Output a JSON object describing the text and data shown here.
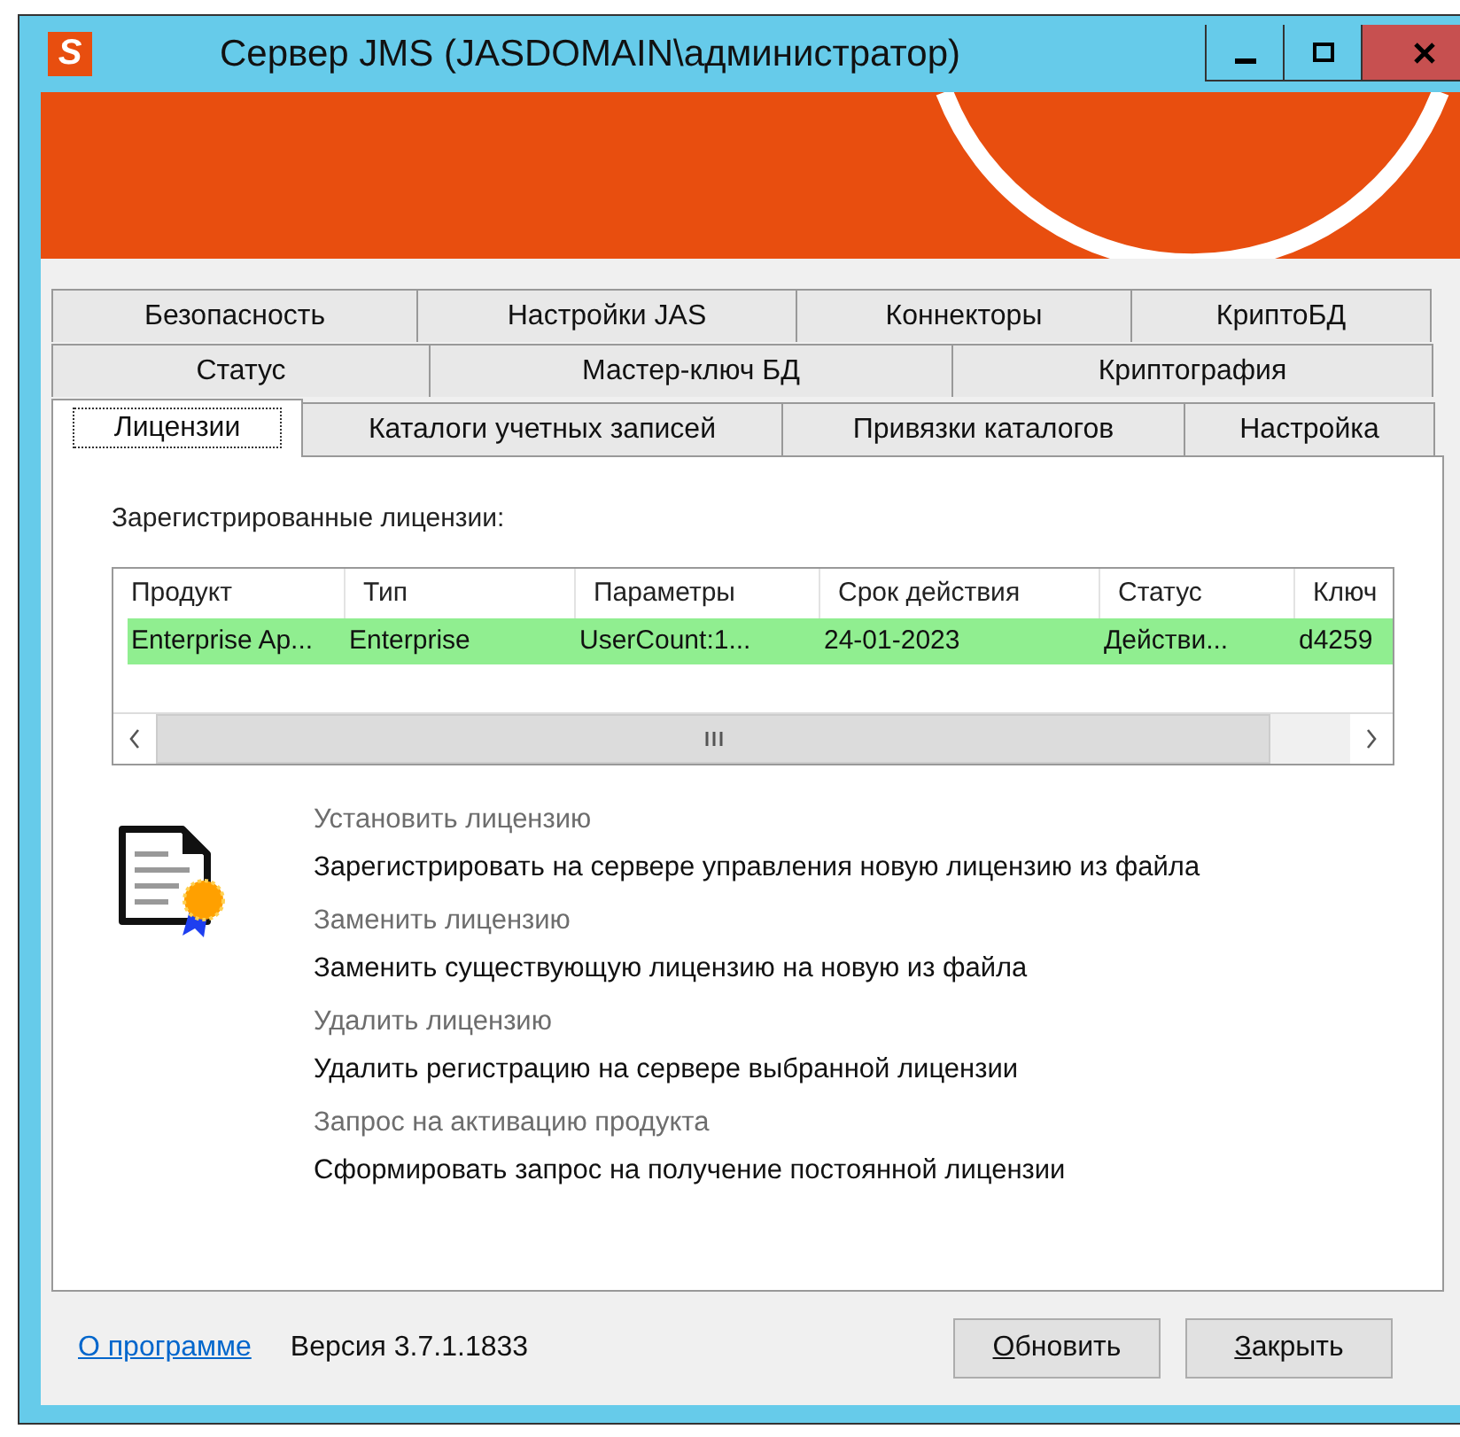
{
  "window": {
    "title": "Сервер JMS (JASDOMAIN\\администратор)",
    "app_icon_letter": "S"
  },
  "tab_rows": [
    [
      {
        "label": "Безопасность",
        "selected": false
      },
      {
        "label": "Настройки JAS",
        "selected": false
      },
      {
        "label": "Коннекторы",
        "selected": false
      },
      {
        "label": "КриптоБД",
        "selected": false
      }
    ],
    [
      {
        "label": "Статус",
        "selected": false
      },
      {
        "label": "Мастер-ключ БД",
        "selected": false
      },
      {
        "label": "Криптография",
        "selected": false
      }
    ],
    [
      {
        "label": "Лицензии",
        "selected": true
      },
      {
        "label": "Каталоги учетных записей",
        "selected": false
      },
      {
        "label": "Привязки каталогов",
        "selected": false
      },
      {
        "label": "Настройка",
        "selected": false
      }
    ]
  ],
  "licenses_label": "Зарегистрированные лицензии:",
  "table": {
    "columns": [
      "Продукт",
      "Тип",
      "Параметры",
      "Срок действия",
      "Статус",
      "Ключ"
    ],
    "rows": [
      {
        "cells": [
          "Enterprise Ap...",
          "Enterprise",
          "UserCount:1...",
          "24-01-2023",
          "Действи...",
          "d4259"
        ],
        "selected": true
      }
    ]
  },
  "actions": [
    {
      "title": "Установить лицензию",
      "description": "Зарегистрировать на сервере управления новую лицензию из файла"
    },
    {
      "title": "Заменить лицензию",
      "description": "Заменить существующую лицензию на новую из файла"
    },
    {
      "title": "Удалить лицензию",
      "description": "Удалить регистрацию на сервере выбранной лицензии"
    },
    {
      "title": "Запрос на активацию продукта",
      "description": "Сформировать запрос на получение постоянной лицензии"
    }
  ],
  "footer": {
    "about_link": "О программе",
    "version": "Версия 3.7.1.1833",
    "buttons": [
      "Обновить",
      "Закрыть"
    ]
  }
}
